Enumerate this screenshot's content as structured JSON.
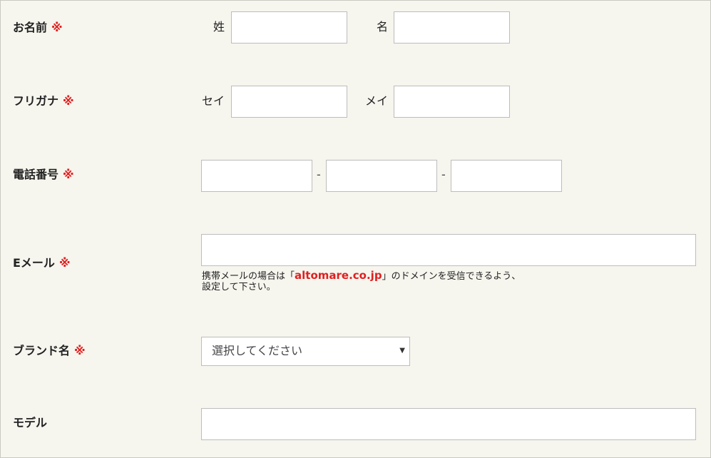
{
  "required_mark": "※",
  "rows": {
    "name": {
      "label": "お名前",
      "last_prefix": "姓",
      "first_prefix": "名"
    },
    "furigana": {
      "label": "フリガナ",
      "last_prefix": "セイ",
      "first_prefix": "メイ"
    },
    "phone": {
      "label": "電話番号",
      "separator": "-"
    },
    "email": {
      "label": "Eメール",
      "note_before": "携帯メールの場合は「",
      "note_domain": "altomare.co.jp",
      "note_after": "」のドメインを受信できるよう、",
      "note_line2": "設定して下さい。"
    },
    "brand": {
      "label": "ブランド名",
      "select_value": "選択してください",
      "caret_icon": "▼"
    },
    "model": {
      "label": "モデル"
    }
  },
  "colors": {
    "background": "#f6f5ee",
    "required": "#e02020",
    "border": "#bdbdbd"
  }
}
